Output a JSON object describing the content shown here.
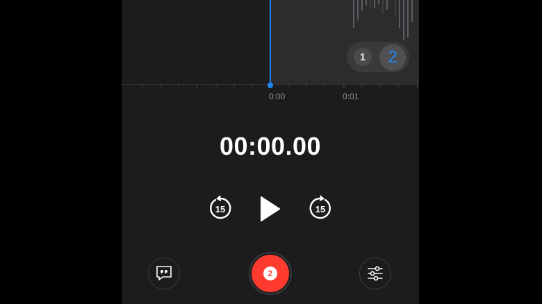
{
  "waveform": {
    "ruler_labels": [
      "0:00",
      "0:01"
    ]
  },
  "takes": {
    "take_1_label": "1",
    "take_2_label": "2",
    "selected": "2"
  },
  "timer": {
    "elapsed": "00:00.00"
  },
  "transport": {
    "skip_back_label": "15",
    "skip_forward_label": "15"
  },
  "record": {
    "badge": "2"
  },
  "icons": {
    "transcript": "quote-bubble-icon",
    "options": "sliders-icon",
    "play": "play-icon",
    "skip_back": "skip-back-15-icon",
    "skip_forward": "skip-forward-15-icon"
  },
  "colors": {
    "accent": "#1e88f0",
    "record": "#ff3b30",
    "background": "#1c1c1e"
  }
}
